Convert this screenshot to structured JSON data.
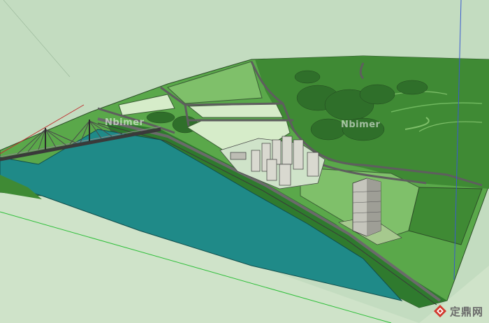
{
  "viewport": {
    "colors": {
      "sky": "#c3dcc0",
      "ground_light": "#cfe3c9",
      "terrain_dark": "#3f8a34",
      "terrain_mid": "#5aa84a",
      "terrain_light": "#7fc06a",
      "field_pale": "#d6ecc9",
      "water": "#1f8a88",
      "road": "#5e5e5e",
      "building": "#cfcfc7",
      "axis_green": "#2fbf3a",
      "axis_red": "#c03030"
    }
  },
  "watermarks": {
    "left": "Nbimer",
    "right": "Nbimer"
  },
  "logo": {
    "text": "定鼎网",
    "icon": "diamond-logo-icon"
  }
}
